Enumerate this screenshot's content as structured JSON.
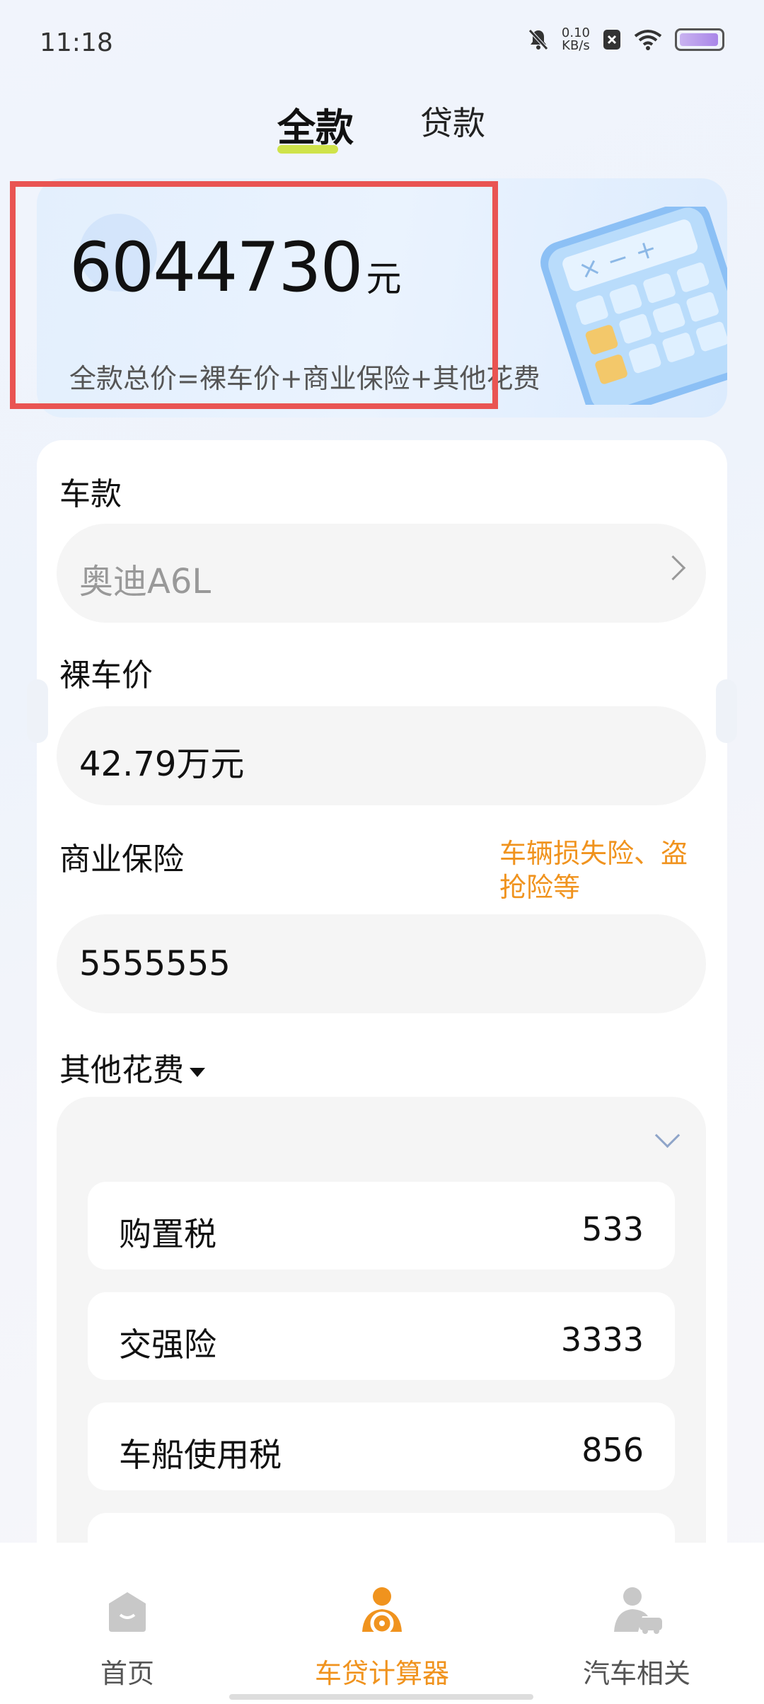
{
  "status": {
    "time": "11:18",
    "net_speed_value": "0.10",
    "net_speed_unit": "KB/s"
  },
  "tabs": [
    {
      "label": "全款",
      "active": true
    },
    {
      "label": "贷款",
      "active": false
    }
  ],
  "summary": {
    "total_value": "6044730",
    "total_unit": "元",
    "formula": "全款总价=裸车价+商业保险+其他花费"
  },
  "form": {
    "model_label": "车款",
    "model_value": "奥迪A6L",
    "price_label": "裸车价",
    "price_value": "42.79万元",
    "insurance_label": "商业保险",
    "insurance_hint": "车辆损失险、盗抢险等",
    "insurance_value": "5555555",
    "others_label": "其他花费",
    "others_items": [
      {
        "name": "购置税",
        "value": "533"
      },
      {
        "name": "交强险",
        "value": "3333"
      },
      {
        "name": "车船使用税",
        "value": "856"
      }
    ]
  },
  "bottom_nav": [
    {
      "label": "首页",
      "icon": "home-icon",
      "active": false
    },
    {
      "label": "车贷计算器",
      "icon": "driver-icon",
      "active": true
    },
    {
      "label": "汽车相关",
      "icon": "car-owner-icon",
      "active": false
    }
  ],
  "colors": {
    "accent": "#f0931e",
    "highlight_box": "#e95452",
    "tab_underline": "#cfe34a"
  }
}
